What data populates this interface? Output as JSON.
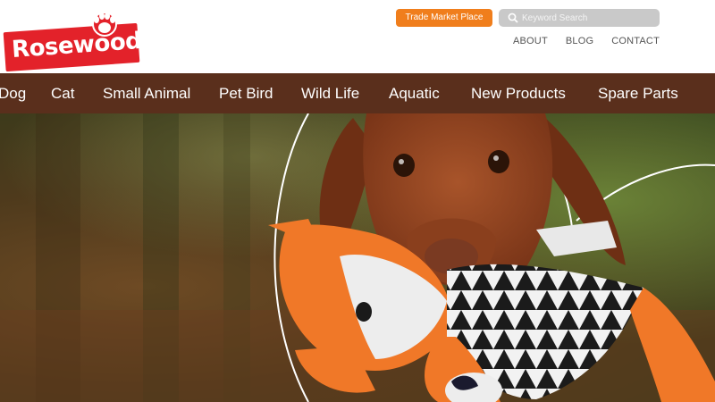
{
  "brand": {
    "name": "Rosewood",
    "primary_color": "#e3222a"
  },
  "header": {
    "trade_button": "Trade Market Place",
    "search": {
      "placeholder": "Keyword Search",
      "icon": "search-icon"
    },
    "links": [
      "ABOUT",
      "BLOG",
      "CONTACT"
    ]
  },
  "nav": {
    "background": "#5a2f1c",
    "items": [
      "Dog",
      "Cat",
      "Small Animal",
      "Pet Bird",
      "Wild Life",
      "Aquatic",
      "New Products",
      "Spare Parts"
    ]
  },
  "hero": {
    "image": "dog-with-fox-plush-toy-photo"
  }
}
